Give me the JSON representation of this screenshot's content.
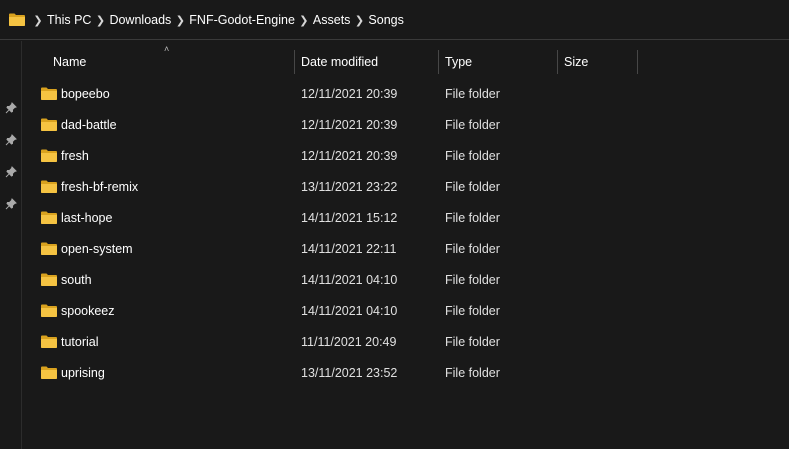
{
  "breadcrumb": {
    "items": [
      "This PC",
      "Downloads",
      "FNF-Godot-Engine",
      "Assets",
      "Songs"
    ]
  },
  "columns": {
    "name": "Name",
    "date": "Date modified",
    "type": "Type",
    "size": "Size"
  },
  "files": [
    {
      "name": "bopeebo",
      "date": "12/11/2021 20:39",
      "type": "File folder",
      "size": ""
    },
    {
      "name": "dad-battle",
      "date": "12/11/2021 20:39",
      "type": "File folder",
      "size": ""
    },
    {
      "name": "fresh",
      "date": "12/11/2021 20:39",
      "type": "File folder",
      "size": ""
    },
    {
      "name": "fresh-bf-remix",
      "date": "13/11/2021 23:22",
      "type": "File folder",
      "size": ""
    },
    {
      "name": "last-hope",
      "date": "14/11/2021 15:12",
      "type": "File folder",
      "size": ""
    },
    {
      "name": "open-system",
      "date": "14/11/2021 22:11",
      "type": "File folder",
      "size": ""
    },
    {
      "name": "south",
      "date": "14/11/2021 04:10",
      "type": "File folder",
      "size": ""
    },
    {
      "name": "spookeez",
      "date": "14/11/2021 04:10",
      "type": "File folder",
      "size": ""
    },
    {
      "name": "tutorial",
      "date": "11/11/2021 20:49",
      "type": "File folder",
      "size": ""
    },
    {
      "name": "uprising",
      "date": "13/11/2021 23:52",
      "type": "File folder",
      "size": ""
    }
  ],
  "icons": {
    "folder": "folder-icon",
    "separator": "chevron-right-icon",
    "pin": "pin-icon",
    "sort": "sort-ascending-icon"
  },
  "colors": {
    "background": "#191919",
    "folder_yellow": "#f5c342",
    "folder_dark": "#d9a21f",
    "text": "#ffffff"
  }
}
